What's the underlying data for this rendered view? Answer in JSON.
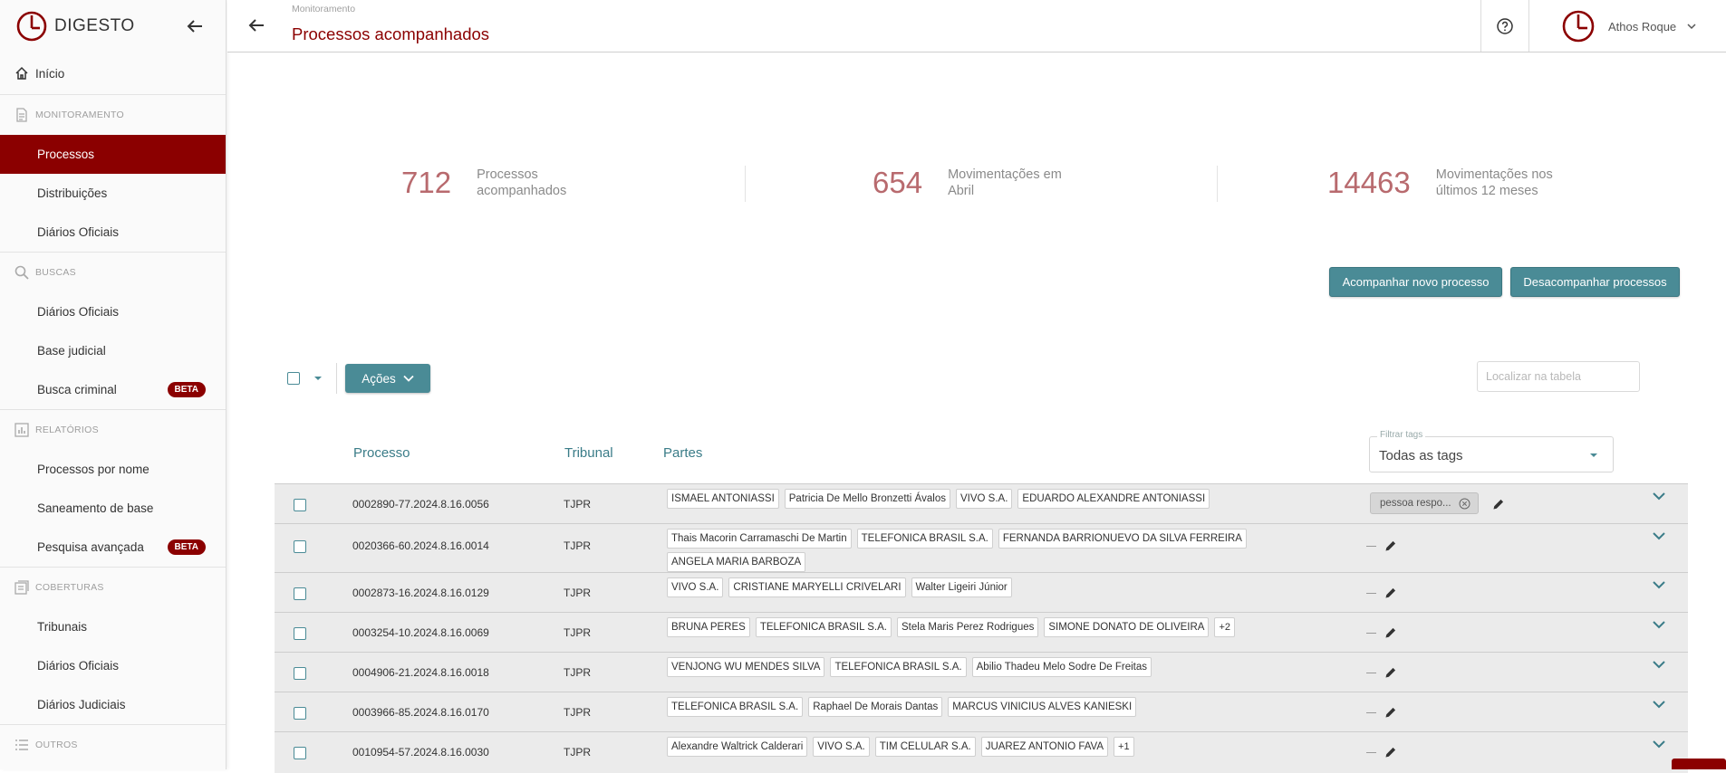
{
  "brand": {
    "name": "DIGESTO"
  },
  "sidebar": {
    "home": "Início",
    "sections": [
      {
        "title": "MONITORAMENTO",
        "items": [
          {
            "label": "Processos",
            "active": true
          },
          {
            "label": "Distribuições"
          },
          {
            "label": "Diários Oficiais"
          }
        ]
      },
      {
        "title": "BUSCAS",
        "items": [
          {
            "label": "Diários Oficiais"
          },
          {
            "label": "Base judicial"
          },
          {
            "label": "Busca criminal",
            "badge": "BETA"
          }
        ]
      },
      {
        "title": "RELATÓRIOS",
        "items": [
          {
            "label": "Processos por nome"
          },
          {
            "label": "Saneamento de base"
          },
          {
            "label": "Pesquisa avançada",
            "badge": "BETA"
          }
        ]
      },
      {
        "title": "COBERTURAS",
        "items": [
          {
            "label": "Tribunais"
          },
          {
            "label": "Diários Oficiais"
          },
          {
            "label": "Diários Judiciais"
          }
        ]
      },
      {
        "title": "OUTROS",
        "items": []
      }
    ]
  },
  "header": {
    "breadcrumb": "Monitoramento",
    "title": "Processos acompanhados",
    "user_name": "Athos Roque"
  },
  "stats": [
    {
      "value": "712",
      "label": "Processos acompanhados"
    },
    {
      "value": "654",
      "label": "Movimentações em Abril"
    },
    {
      "value": "14463",
      "label": "Movimentações nos últimos 12 meses"
    }
  ],
  "actions": {
    "follow": "Acompanhar novo processo",
    "unfollow": "Desacompanhar processos",
    "menu": "Ações"
  },
  "search": {
    "placeholder": "Localizar na tabela"
  },
  "table": {
    "columns": {
      "processo": "Processo",
      "tribunal": "Tribunal",
      "partes": "Partes"
    },
    "filter": {
      "label": "Filtrar tags",
      "value": "Todas as tags"
    },
    "rows": [
      {
        "processo": "0002890-77.2024.8.16.0056",
        "tribunal": "TJPR",
        "partes": [
          "ISMAEL ANTONIASSI",
          "Patricia De Mello Bronzetti Ávalos",
          "VIVO S.A.",
          "EDUARDO ALEXANDRE ANTONIASSI"
        ],
        "more": "",
        "tag": "pessoa respo..."
      },
      {
        "processo": "0020366-60.2024.8.16.0014",
        "tribunal": "TJPR",
        "partes": [
          "Thais Macorin Carramaschi De Martin",
          "TELEFONICA BRASIL S.A.",
          "FERNANDA BARRIONUEVO DA SILVA FERREIRA",
          "ANGELA MARIA BARBOZA"
        ],
        "more": "",
        "tag": ""
      },
      {
        "processo": "0002873-16.2024.8.16.0129",
        "tribunal": "TJPR",
        "partes": [
          "VIVO S.A.",
          "CRISTIANE MARYELLI CRIVELARI",
          "Walter Ligeiri Júnior"
        ],
        "more": "",
        "tag": ""
      },
      {
        "processo": "0003254-10.2024.8.16.0069",
        "tribunal": "TJPR",
        "partes": [
          "BRUNA PERES",
          "TELEFONICA BRASIL S.A.",
          "Stela Maris Perez Rodrigues",
          "SIMONE DONATO DE OLIVEIRA"
        ],
        "more": "+2",
        "tag": ""
      },
      {
        "processo": "0004906-21.2024.8.16.0018",
        "tribunal": "TJPR",
        "partes": [
          "VENJONG WU MENDES SILVA",
          "TELEFONICA BRASIL S.A.",
          "Abilio Thadeu Melo Sodre De Freitas"
        ],
        "more": "",
        "tag": ""
      },
      {
        "processo": "0003966-85.2024.8.16.0170",
        "tribunal": "TJPR",
        "partes": [
          "TELEFONICA BRASIL S.A.",
          "Raphael De Morais Dantas",
          "MARCUS VINICIUS ALVES KANIESKI"
        ],
        "more": "",
        "tag": ""
      },
      {
        "processo": "0010954-57.2024.8.16.0030",
        "tribunal": "TJPR",
        "partes": [
          "Alexandre Waltrick Calderari",
          "VIVO S.A.",
          "TIM CELULAR S.A.",
          "JUAREZ ANTONIO FAVA"
        ],
        "more": "+1",
        "tag": ""
      }
    ]
  },
  "colors": {
    "brand": "#8b0000",
    "accent": "#4a8b96",
    "stat": "#b86a6e"
  }
}
